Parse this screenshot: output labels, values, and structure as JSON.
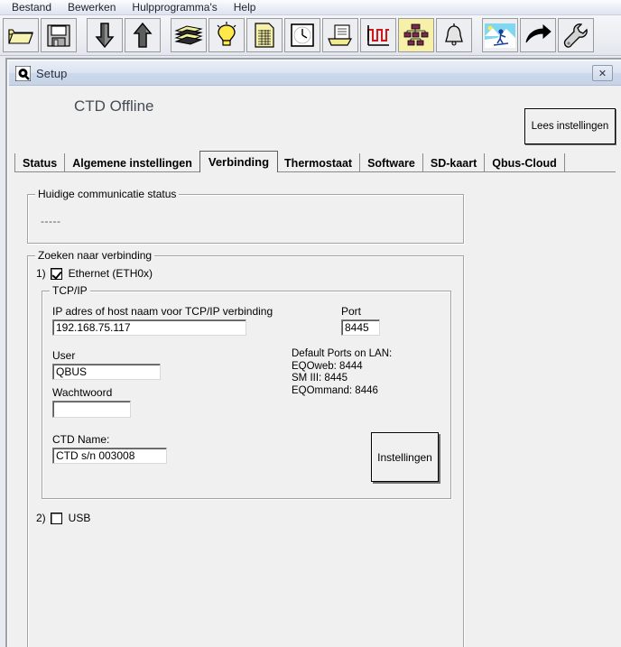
{
  "menubar": {
    "items": [
      {
        "label": "Bestand",
        "name": "menu-bestand"
      },
      {
        "label": "Bewerken",
        "name": "menu-bewerken"
      },
      {
        "label": "Hulpprogramma's",
        "name": "menu-hulpprogrammas"
      },
      {
        "label": "Help",
        "name": "menu-help"
      }
    ]
  },
  "toolbar": {
    "groups": [
      [
        "open-folder-icon",
        "save-floppy-disk-icon"
      ],
      [
        "download-arrow-down-icon",
        "upload-arrow-up-icon"
      ],
      [
        "books-stack-icon",
        "lightbulb-icon",
        "spreadsheet-icon",
        "clock-icon",
        "printer-icon",
        "waveform-chart-icon",
        "network-diagram-icon",
        "bell-icon"
      ],
      [
        "skier-image-icon",
        "forward-arrow-icon",
        "wrench-icon"
      ]
    ]
  },
  "window": {
    "title": "Setup",
    "logo_icon": "qbus-logo-icon",
    "close_icon": "close-icon",
    "close_label": "✕"
  },
  "header": {
    "title": "CTD Offline",
    "read_settings_label": "Lees instellingen"
  },
  "tabs": [
    {
      "label": "Status",
      "name": "tab-status",
      "active": false
    },
    {
      "label": "Algemene instellingen",
      "name": "tab-algemene-instellingen",
      "active": false
    },
    {
      "label": "Verbinding",
      "name": "tab-verbinding",
      "active": true
    },
    {
      "label": "Thermostaat",
      "name": "tab-thermostaat",
      "active": false
    },
    {
      "label": "Software",
      "name": "tab-software",
      "active": false
    },
    {
      "label": "SD-kaart",
      "name": "tab-sd-kaart",
      "active": false
    },
    {
      "label": "Qbus-Cloud",
      "name": "tab-qbus-cloud",
      "active": false
    }
  ],
  "status_group": {
    "legend": "Huidige communicatie status",
    "value": "-----"
  },
  "search_group": {
    "legend": "Zoeken naar verbinding",
    "ethernet": {
      "number": "1)",
      "label": "Ethernet (ETH0x)",
      "checked": true
    },
    "usb": {
      "number": "2)",
      "label": "USB",
      "checked": false
    }
  },
  "tcpip_group": {
    "legend": "TCP/IP",
    "ip_label": "IP adres of host naam voor TCP/IP verbinding",
    "ip_value": "192.168.75.117",
    "port_label": "Port",
    "port_value": "8445",
    "user_label": "User",
    "user_value": "QBUS",
    "password_label": "Wachtwoord",
    "password_value": "",
    "ctd_name_label": "CTD Name:",
    "ctd_name_value": "CTD s/n 003008",
    "default_ports_info": "Default Ports on LAN:\nEQOweb: 8444\nSM III: 8445\nEQOmmand: 8446",
    "settings_button_label": "Instellingen"
  }
}
